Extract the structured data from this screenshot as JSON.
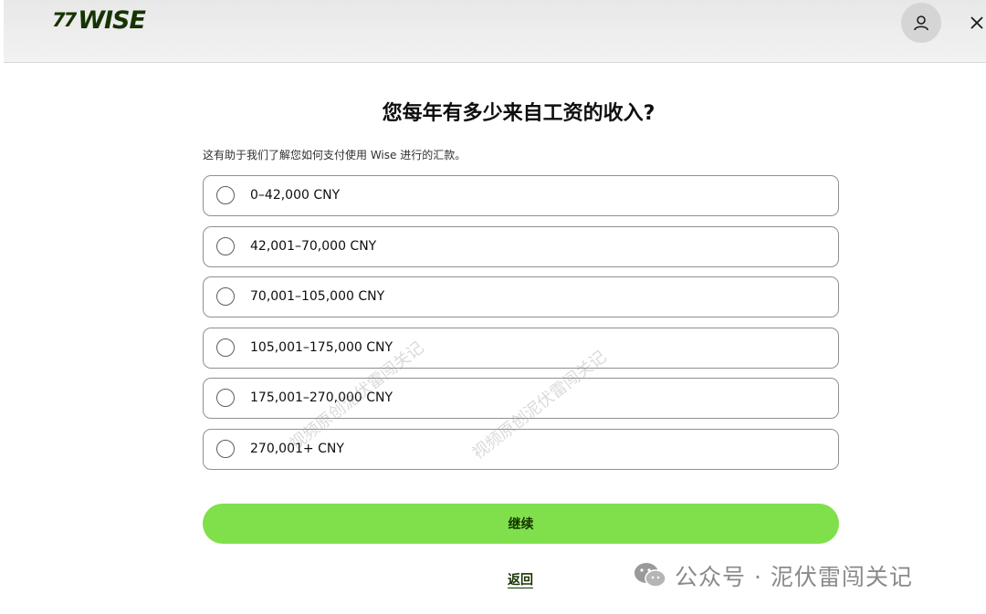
{
  "header": {
    "logo_mark": "77",
    "logo_text": "WISE"
  },
  "question": {
    "title": "您每年有多少来自工资的收入?",
    "subtitle": "这有助于我们了解您如何支付使用 Wise 进行的汇款。"
  },
  "options": [
    {
      "label": "0–42,000 CNY"
    },
    {
      "label": "42,001–70,000 CNY"
    },
    {
      "label": "70,001–105,000 CNY"
    },
    {
      "label": "105,001–175,000 CNY"
    },
    {
      "label": "175,001–270,000 CNY"
    },
    {
      "label": "270,001+ CNY"
    }
  ],
  "actions": {
    "continue_label": "继续",
    "back_label": "返回"
  },
  "watermark": {
    "text": "公众号 · 泥伏雷闯关记",
    "diag_1": "视频原创泥伏雷闯关记",
    "diag_2": "视频原创泥伏雷闯关记"
  },
  "colors": {
    "accent_green": "#80e04c",
    "brand_dark": "#163300"
  }
}
